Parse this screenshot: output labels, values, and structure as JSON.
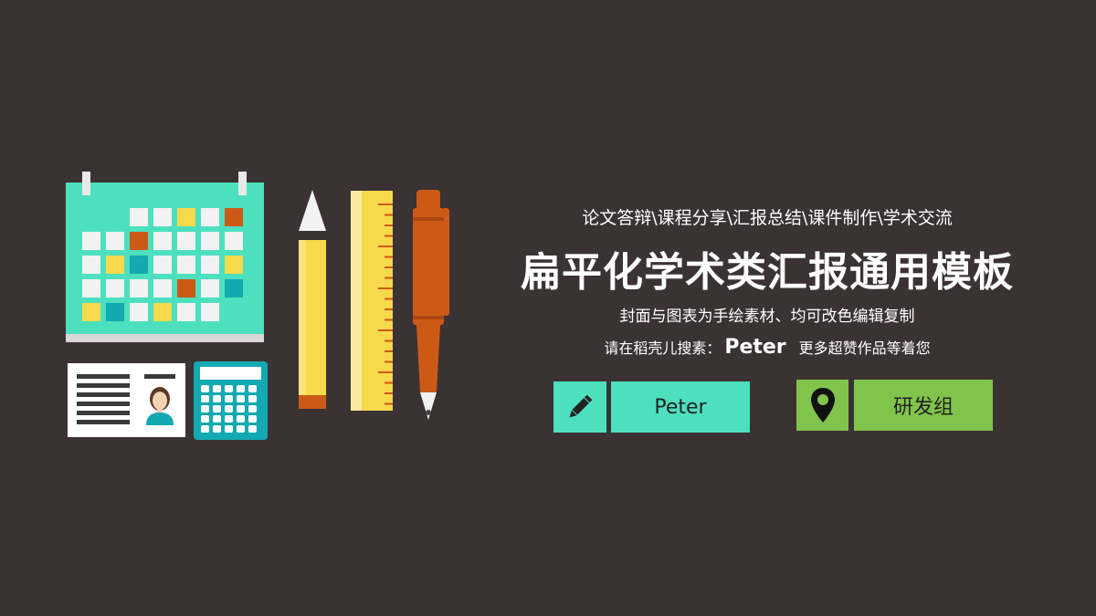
{
  "subtitle": "论文答辩\\课程分享\\汇报总结\\课件制作\\学术交流",
  "title": "扁平化学术类汇报通用模板",
  "description": "封面与图表为手绘素材、均可改色编辑复制",
  "search": {
    "prefix": "请在稻壳儿搜素：",
    "name": "Peter",
    "suffix": "更多超赞作品等着您"
  },
  "author_button": {
    "label": "Peter",
    "icon": "pencil-icon"
  },
  "group_button": {
    "label": "研发组",
    "icon": "location-pin-icon"
  },
  "colors": {
    "background": "#3b3234",
    "teal": "#4de0bf",
    "green": "#80c44b",
    "yellow": "#f7d94c",
    "orange": "#cc5a16",
    "cyan": "#13a9b0"
  }
}
